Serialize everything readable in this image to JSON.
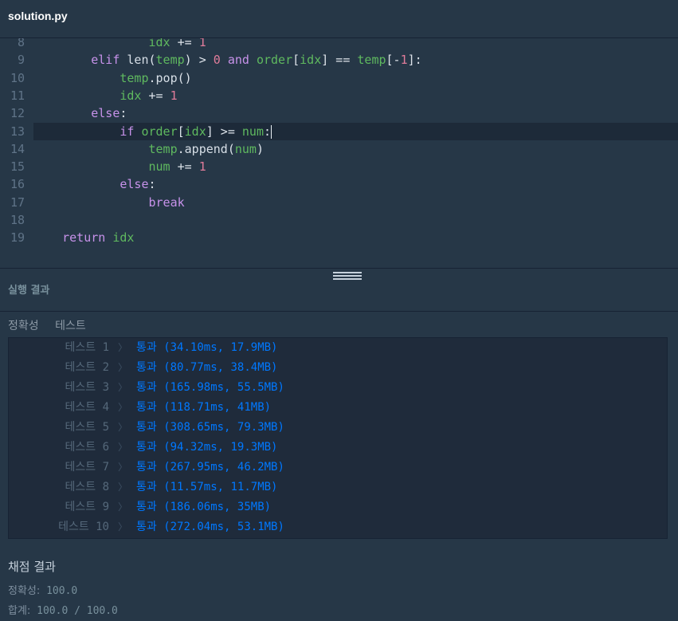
{
  "tab": {
    "filename": "solution.py"
  },
  "editor": {
    "lines": [
      {
        "num": "8",
        "tokens": [
          [
            "                ",
            ""
          ],
          [
            "idx",
            "var"
          ],
          [
            " += ",
            "op"
          ],
          [
            "1",
            "num"
          ]
        ]
      },
      {
        "num": "9",
        "tokens": [
          [
            "        ",
            ""
          ],
          [
            "elif",
            "kw"
          ],
          [
            " ",
            ""
          ],
          [
            "len",
            "fn"
          ],
          [
            "(",
            "op"
          ],
          [
            "temp",
            "var"
          ],
          [
            ") > ",
            "op"
          ],
          [
            "0",
            "num"
          ],
          [
            " ",
            ""
          ],
          [
            "and",
            "kw"
          ],
          [
            " ",
            ""
          ],
          [
            "order",
            "var"
          ],
          [
            "[",
            "op"
          ],
          [
            "idx",
            "var"
          ],
          [
            "] == ",
            "op"
          ],
          [
            "temp",
            "var"
          ],
          [
            "[-",
            "op"
          ],
          [
            "1",
            "num"
          ],
          [
            "]:",
            "op"
          ]
        ]
      },
      {
        "num": "10",
        "tokens": [
          [
            "            ",
            ""
          ],
          [
            "temp",
            "var"
          ],
          [
            ".",
            "op"
          ],
          [
            "pop",
            "fn"
          ],
          [
            "()",
            "op"
          ]
        ]
      },
      {
        "num": "11",
        "tokens": [
          [
            "            ",
            ""
          ],
          [
            "idx",
            "var"
          ],
          [
            " += ",
            "op"
          ],
          [
            "1",
            "num"
          ]
        ]
      },
      {
        "num": "12",
        "tokens": [
          [
            "        ",
            ""
          ],
          [
            "else",
            "kw"
          ],
          [
            ":",
            "op"
          ]
        ]
      },
      {
        "num": "13",
        "tokens": [
          [
            "            ",
            ""
          ],
          [
            "if",
            "kw"
          ],
          [
            " ",
            ""
          ],
          [
            "order",
            "var"
          ],
          [
            "[",
            "op"
          ],
          [
            "idx",
            "var"
          ],
          [
            "] >= ",
            "op"
          ],
          [
            "num",
            "var"
          ],
          [
            ":",
            "op"
          ]
        ]
      },
      {
        "num": "14",
        "tokens": [
          [
            "                ",
            ""
          ],
          [
            "temp",
            "var"
          ],
          [
            ".",
            "op"
          ],
          [
            "append",
            "fn"
          ],
          [
            "(",
            "op"
          ],
          [
            "num",
            "var"
          ],
          [
            ")",
            "op"
          ]
        ]
      },
      {
        "num": "15",
        "tokens": [
          [
            "                ",
            ""
          ],
          [
            "num",
            "var"
          ],
          [
            " += ",
            "op"
          ],
          [
            "1",
            "num"
          ]
        ]
      },
      {
        "num": "16",
        "tokens": [
          [
            "            ",
            ""
          ],
          [
            "else",
            "kw"
          ],
          [
            ":",
            "op"
          ]
        ]
      },
      {
        "num": "17",
        "tokens": [
          [
            "                ",
            ""
          ],
          [
            "break",
            "kw"
          ]
        ]
      },
      {
        "num": "18",
        "tokens": []
      },
      {
        "num": "19",
        "tokens": [
          [
            "    ",
            ""
          ],
          [
            "return",
            "kw"
          ],
          [
            " ",
            ""
          ],
          [
            "idx",
            "var"
          ]
        ]
      }
    ]
  },
  "run": {
    "title": "실행 결과"
  },
  "tabs": {
    "correctness": "정확성",
    "test": "테스트"
  },
  "tests": [
    {
      "name": "테스트 1",
      "result": "통과 (34.10ms, 17.9MB)"
    },
    {
      "name": "테스트 2",
      "result": "통과 (80.77ms, 38.4MB)"
    },
    {
      "name": "테스트 3",
      "result": "통과 (165.98ms, 55.5MB)"
    },
    {
      "name": "테스트 4",
      "result": "통과 (118.71ms, 41MB)"
    },
    {
      "name": "테스트 5",
      "result": "통과 (308.65ms, 79.3MB)"
    },
    {
      "name": "테스트 6",
      "result": "통과 (94.32ms, 19.3MB)"
    },
    {
      "name": "테스트 7",
      "result": "통과 (267.95ms, 46.2MB)"
    },
    {
      "name": "테스트 8",
      "result": "통과 (11.57ms, 11.7MB)"
    },
    {
      "name": "테스트 9",
      "result": "통과 (186.06ms, 35MB)"
    },
    {
      "name": "테스트 10",
      "result": "통과 (272.04ms, 53.1MB)"
    }
  ],
  "scoring": {
    "title": "채점 결과",
    "correctness_label": "정확성:",
    "correctness_value": "100.0",
    "total_label": "합계:",
    "total_value": "100.0 / 100.0"
  }
}
